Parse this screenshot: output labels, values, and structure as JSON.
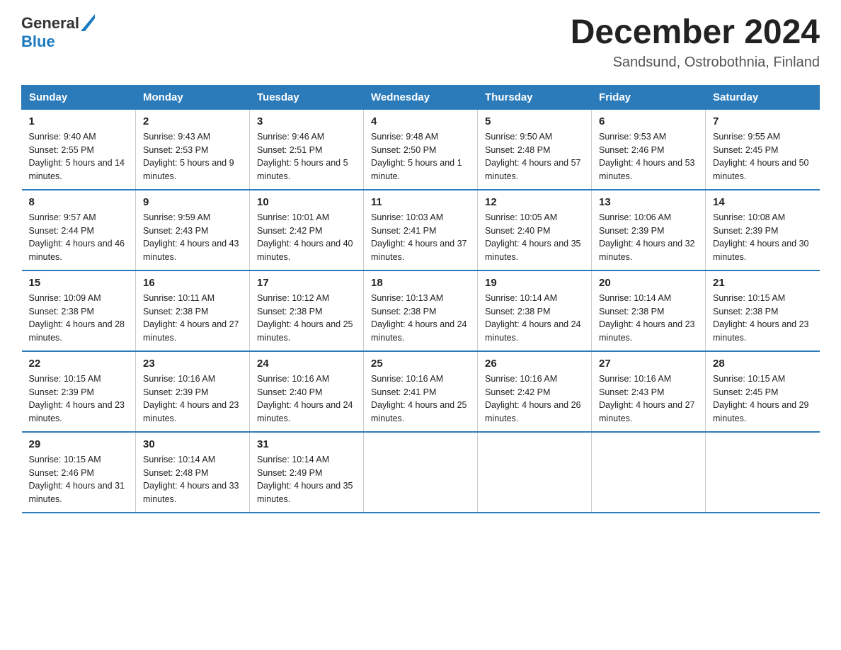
{
  "logo": {
    "general": "General",
    "blue": "Blue"
  },
  "title": "December 2024",
  "subtitle": "Sandsund, Ostrobothnia, Finland",
  "days_of_week": [
    "Sunday",
    "Monday",
    "Tuesday",
    "Wednesday",
    "Thursday",
    "Friday",
    "Saturday"
  ],
  "weeks": [
    [
      {
        "day": "1",
        "sunrise": "9:40 AM",
        "sunset": "2:55 PM",
        "daylight": "5 hours and 14 minutes."
      },
      {
        "day": "2",
        "sunrise": "9:43 AM",
        "sunset": "2:53 PM",
        "daylight": "5 hours and 9 minutes."
      },
      {
        "day": "3",
        "sunrise": "9:46 AM",
        "sunset": "2:51 PM",
        "daylight": "5 hours and 5 minutes."
      },
      {
        "day": "4",
        "sunrise": "9:48 AM",
        "sunset": "2:50 PM",
        "daylight": "5 hours and 1 minute."
      },
      {
        "day": "5",
        "sunrise": "9:50 AM",
        "sunset": "2:48 PM",
        "daylight": "4 hours and 57 minutes."
      },
      {
        "day": "6",
        "sunrise": "9:53 AM",
        "sunset": "2:46 PM",
        "daylight": "4 hours and 53 minutes."
      },
      {
        "day": "7",
        "sunrise": "9:55 AM",
        "sunset": "2:45 PM",
        "daylight": "4 hours and 50 minutes."
      }
    ],
    [
      {
        "day": "8",
        "sunrise": "9:57 AM",
        "sunset": "2:44 PM",
        "daylight": "4 hours and 46 minutes."
      },
      {
        "day": "9",
        "sunrise": "9:59 AM",
        "sunset": "2:43 PM",
        "daylight": "4 hours and 43 minutes."
      },
      {
        "day": "10",
        "sunrise": "10:01 AM",
        "sunset": "2:42 PM",
        "daylight": "4 hours and 40 minutes."
      },
      {
        "day": "11",
        "sunrise": "10:03 AM",
        "sunset": "2:41 PM",
        "daylight": "4 hours and 37 minutes."
      },
      {
        "day": "12",
        "sunrise": "10:05 AM",
        "sunset": "2:40 PM",
        "daylight": "4 hours and 35 minutes."
      },
      {
        "day": "13",
        "sunrise": "10:06 AM",
        "sunset": "2:39 PM",
        "daylight": "4 hours and 32 minutes."
      },
      {
        "day": "14",
        "sunrise": "10:08 AM",
        "sunset": "2:39 PM",
        "daylight": "4 hours and 30 minutes."
      }
    ],
    [
      {
        "day": "15",
        "sunrise": "10:09 AM",
        "sunset": "2:38 PM",
        "daylight": "4 hours and 28 minutes."
      },
      {
        "day": "16",
        "sunrise": "10:11 AM",
        "sunset": "2:38 PM",
        "daylight": "4 hours and 27 minutes."
      },
      {
        "day": "17",
        "sunrise": "10:12 AM",
        "sunset": "2:38 PM",
        "daylight": "4 hours and 25 minutes."
      },
      {
        "day": "18",
        "sunrise": "10:13 AM",
        "sunset": "2:38 PM",
        "daylight": "4 hours and 24 minutes."
      },
      {
        "day": "19",
        "sunrise": "10:14 AM",
        "sunset": "2:38 PM",
        "daylight": "4 hours and 24 minutes."
      },
      {
        "day": "20",
        "sunrise": "10:14 AM",
        "sunset": "2:38 PM",
        "daylight": "4 hours and 23 minutes."
      },
      {
        "day": "21",
        "sunrise": "10:15 AM",
        "sunset": "2:38 PM",
        "daylight": "4 hours and 23 minutes."
      }
    ],
    [
      {
        "day": "22",
        "sunrise": "10:15 AM",
        "sunset": "2:39 PM",
        "daylight": "4 hours and 23 minutes."
      },
      {
        "day": "23",
        "sunrise": "10:16 AM",
        "sunset": "2:39 PM",
        "daylight": "4 hours and 23 minutes."
      },
      {
        "day": "24",
        "sunrise": "10:16 AM",
        "sunset": "2:40 PM",
        "daylight": "4 hours and 24 minutes."
      },
      {
        "day": "25",
        "sunrise": "10:16 AM",
        "sunset": "2:41 PM",
        "daylight": "4 hours and 25 minutes."
      },
      {
        "day": "26",
        "sunrise": "10:16 AM",
        "sunset": "2:42 PM",
        "daylight": "4 hours and 26 minutes."
      },
      {
        "day": "27",
        "sunrise": "10:16 AM",
        "sunset": "2:43 PM",
        "daylight": "4 hours and 27 minutes."
      },
      {
        "day": "28",
        "sunrise": "10:15 AM",
        "sunset": "2:45 PM",
        "daylight": "4 hours and 29 minutes."
      }
    ],
    [
      {
        "day": "29",
        "sunrise": "10:15 AM",
        "sunset": "2:46 PM",
        "daylight": "4 hours and 31 minutes."
      },
      {
        "day": "30",
        "sunrise": "10:14 AM",
        "sunset": "2:48 PM",
        "daylight": "4 hours and 33 minutes."
      },
      {
        "day": "31",
        "sunrise": "10:14 AM",
        "sunset": "2:49 PM",
        "daylight": "4 hours and 35 minutes."
      },
      null,
      null,
      null,
      null
    ]
  ]
}
